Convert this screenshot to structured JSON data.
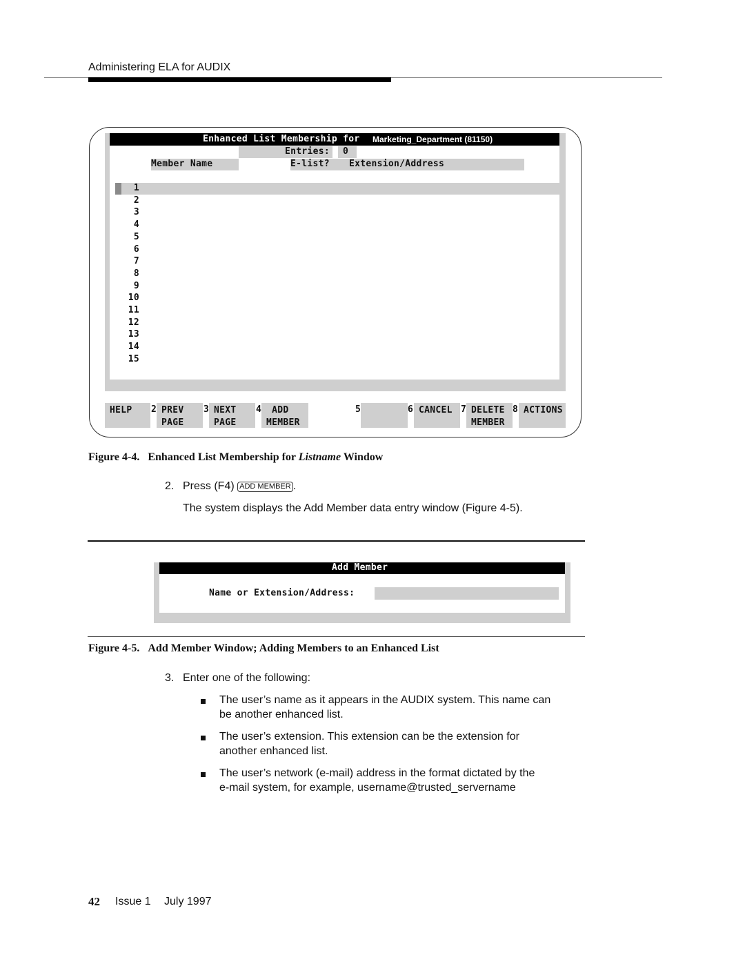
{
  "header": {
    "running_title": "Administering ELA for AUDIX"
  },
  "figure_4_4": {
    "window": {
      "title": "Enhanced List Membership for",
      "list_name": "Marketing_Department (81150)",
      "entries_label": "Entries:",
      "entries_value": "0",
      "columns": {
        "member_name": "Member Name",
        "elist": "E-list?",
        "extension_address": "Extension/Address"
      },
      "rows": [
        "1",
        "2",
        "3",
        "4",
        "5",
        "6",
        "7",
        "8",
        "9",
        "10",
        "11",
        "12",
        "13",
        "14",
        "15"
      ],
      "function_keys": [
        {
          "num": "",
          "label": "HELP"
        },
        {
          "num": "2",
          "label": "PREV\nPAGE"
        },
        {
          "num": "3",
          "label": "NEXT\nPAGE"
        },
        {
          "num": "4",
          "label": " ADD\nMEMBER"
        },
        {
          "num": "5",
          "label": ""
        },
        {
          "num": "6",
          "label": "CANCEL"
        },
        {
          "num": "7",
          "label": "DELETE\nMEMBER"
        },
        {
          "num": "8",
          "label": "ACTIONS"
        }
      ]
    },
    "caption_prefix": "Figure 4-4.",
    "caption_main": "Enhanced List Membership for",
    "caption_italic": "Listname",
    "caption_suffix": "Window"
  },
  "steps": {
    "step2_num": "2.",
    "step2_text": "Press (F4)",
    "step2_key": "ADD MEMBER",
    "step2_end": ".",
    "step2_result": "The system displays the Add Member data entry window (Figure 4-5).",
    "step3_num": "3.",
    "step3_text": "Enter one of the following:",
    "bullets": [
      {
        "line1": "The user’s name as it appears in the AUDIX system. This name can",
        "line2": "be another enhanced list."
      },
      {
        "line1": "The user’s extension. This extension can be the extension for",
        "line2": "another enhanced list."
      },
      {
        "line1": "The user’s network (e-mail) address in the format dictated by the",
        "line2": "e-mail system, for example, username@trusted_servername"
      }
    ]
  },
  "figure_4_5": {
    "window_title": "Add Member",
    "field_label": "Name or Extension/Address:",
    "field_value": "",
    "caption_prefix": "Figure 4-5.",
    "caption_main": "Add Member Window; Adding Members to an Enhanced List"
  },
  "footer": {
    "page_number": "42",
    "issue": "Issue 1",
    "date": "July 1997"
  }
}
